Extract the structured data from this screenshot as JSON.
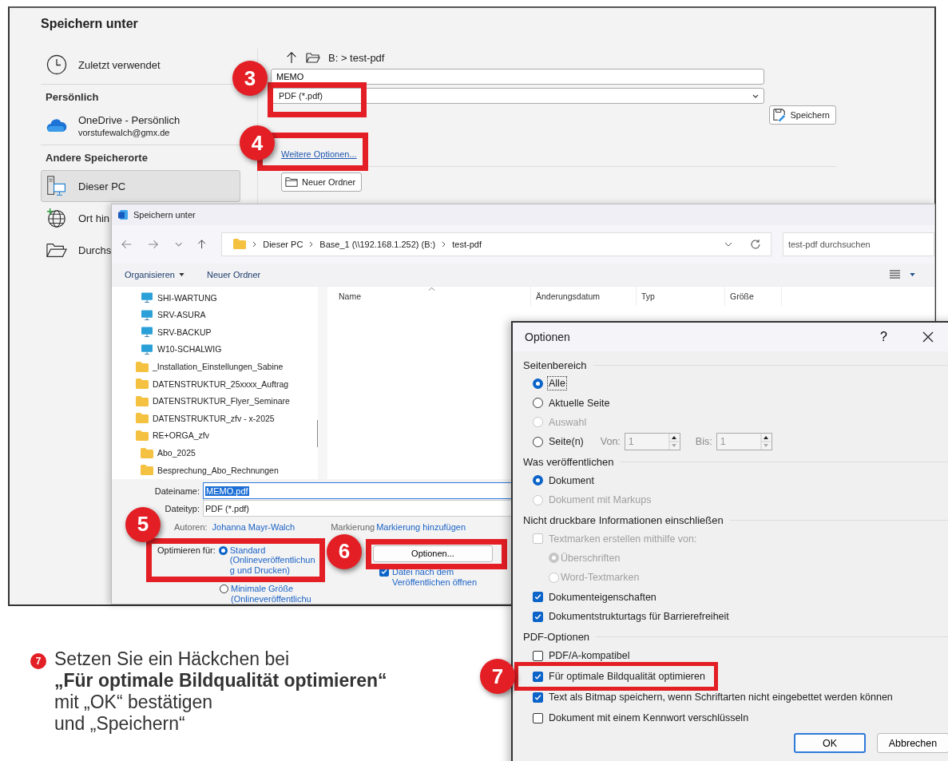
{
  "backstage": {
    "title": "Speichern unter",
    "nav": [
      {
        "kind": "recent",
        "label": "Zuletzt verwendet",
        "selected": false
      },
      {
        "kind": "header",
        "label": "Persönlich"
      },
      {
        "kind": "cloud",
        "label": "OneDrive - Persönlich",
        "sublabel": "vorstufewalch@gmx.de",
        "selected": false
      },
      {
        "kind": "header",
        "label": "Andere Speicherorte"
      },
      {
        "kind": "pc",
        "label": "Dieser PC",
        "selected": true
      },
      {
        "kind": "web",
        "label": "Ort hin",
        "selected": false
      },
      {
        "kind": "browse",
        "label": "Durchs",
        "selected": false
      }
    ],
    "path": "B: > test-pdf",
    "filename": "MEMO",
    "filetype": "PDF (*.pdf)",
    "save_button": "Speichern",
    "more_options_link": "Weitere Optionen...",
    "new_folder_button": "Neuer Ordner"
  },
  "file_dialog": {
    "title": "Speichern unter",
    "breadcrumb": [
      "Dieser PC",
      "Base_1 (\\\\192.168.1.252) (B:)",
      "test-pdf"
    ],
    "search": {
      "placeholder": "test-pdf durchsuchen"
    },
    "organize_button": "Organisieren",
    "new_folder_button": "Neuer Ordner",
    "tree": [
      {
        "kind": "computer",
        "label": "SHI-WARTUNG"
      },
      {
        "kind": "computer",
        "label": "SRV-ASURA"
      },
      {
        "kind": "computer",
        "label": "SRV-BACKUP"
      },
      {
        "kind": "computer",
        "label": "W10-SCHALWIG"
      },
      {
        "kind": "folder",
        "label": "_Installation_Einstellungen_Sabine"
      },
      {
        "kind": "folder",
        "label": "DATENSTRUKTUR_25xxxx_Auftrag"
      },
      {
        "kind": "folder",
        "label": "DATENSTRUKTUR_Flyer_Seminare"
      },
      {
        "kind": "folder",
        "label": "DATENSTRUKTUR_zfv - x-2025"
      },
      {
        "kind": "folder",
        "label": "RE+ORGA_zfv",
        "children": [
          {
            "kind": "folder",
            "label": "Abo_2025"
          },
          {
            "kind": "folder",
            "label": "Besprechung_Abo_Rechnungen"
          }
        ]
      }
    ],
    "columns": [
      "Name",
      "Änderungsdatum",
      "Typ",
      "Größe"
    ],
    "filename_label": "Dateiname:",
    "filename": "MEMO.pdf",
    "filetype_label": "Dateityp:",
    "filetype": "PDF (*.pdf)",
    "authors_label": "Autoren:",
    "authors": "Johanna Mayr-Walch",
    "tags_label": "Markierung",
    "tags_link": "Markierung hinzufügen",
    "optimize_label": "Optimieren für:",
    "optimize_options": [
      {
        "label": "Standard (Onlineveröffentlichung und Drucken)",
        "selected": true
      },
      {
        "label": "Minimale Größe (Onlineveröffentlichu",
        "selected": false
      }
    ],
    "options_button": "Optionen...",
    "open_after": {
      "label": "Datei nach dem Veröffentlichen öffnen",
      "checked": true
    }
  },
  "options_dialog": {
    "title": "Optionen",
    "help": "?",
    "groups": [
      {
        "title": "Seitenbereich",
        "items": [
          {
            "kind": "radio",
            "label": "Alle",
            "selected": true,
            "disabled": false,
            "focused": true
          },
          {
            "kind": "radio",
            "label": "Aktuelle Seite",
            "selected": false,
            "disabled": false,
            "focused": false
          },
          {
            "kind": "radio",
            "label": "Auswahl",
            "selected": false,
            "disabled": true,
            "focused": false
          },
          {
            "kind": "range",
            "label": "Seite(n)",
            "selected": false,
            "disabled": false,
            "focused": false,
            "from_label": "Von:",
            "from": "1",
            "to_label": "Bis:",
            "to": "1",
            "spin_disabled": true
          }
        ]
      },
      {
        "title": "Was veröffentlichen",
        "items": [
          {
            "kind": "radio",
            "label": "Dokument",
            "selected": true,
            "disabled": false,
            "focused": false
          },
          {
            "kind": "radio",
            "label": "Dokument mit Markups",
            "selected": false,
            "disabled": true,
            "focused": false
          }
        ]
      },
      {
        "title": "Nicht druckbare Informationen einschließen",
        "items": [
          {
            "kind": "checkbox",
            "label": "Textmarken erstellen mithilfe von:",
            "checked": false,
            "disabled": true,
            "children": [
              {
                "kind": "radio",
                "label": "Überschriften",
                "selected": true,
                "disabled": true,
                "focused": false
              },
              {
                "kind": "radio",
                "label": "Word-Textmarken",
                "selected": false,
                "disabled": true,
                "focused": false
              }
            ]
          },
          {
            "kind": "checkbox",
            "label": "Dokumenteigenschaften",
            "checked": true,
            "disabled": false
          },
          {
            "kind": "checkbox",
            "label": "Dokumentstrukturtags für Barrierefreiheit",
            "checked": true,
            "disabled": false
          }
        ]
      },
      {
        "title": "PDF-Optionen",
        "items": [
          {
            "kind": "checkbox",
            "label": "PDF/A-kompatibel",
            "checked": false,
            "disabled": false
          },
          {
            "kind": "checkbox",
            "label": "Für optimale Bildqualität optimieren",
            "checked": true,
            "disabled": false
          },
          {
            "kind": "checkbox",
            "label": "Text als Bitmap speichern, wenn Schriftarten nicht eingebettet werden können",
            "checked": true,
            "disabled": false
          },
          {
            "kind": "checkbox",
            "label": "Dokument mit einem Kennwort verschlüsseln",
            "checked": false,
            "disabled": false
          }
        ]
      }
    ],
    "buttons": [
      {
        "label": "OK",
        "default": true
      },
      {
        "label": "Abbrechen",
        "default": false
      }
    ]
  },
  "callouts": [
    {
      "number": "3"
    },
    {
      "number": "4"
    },
    {
      "number": "5"
    },
    {
      "number": "6"
    },
    {
      "number": "7"
    }
  ],
  "caption": {
    "number": "7",
    "text": "Setzen Sie ein Häckchen bei\n**„Für optimale Bildqualität optimieren“**\nmit „OK“ bestätigen\nund „Speichern“"
  }
}
